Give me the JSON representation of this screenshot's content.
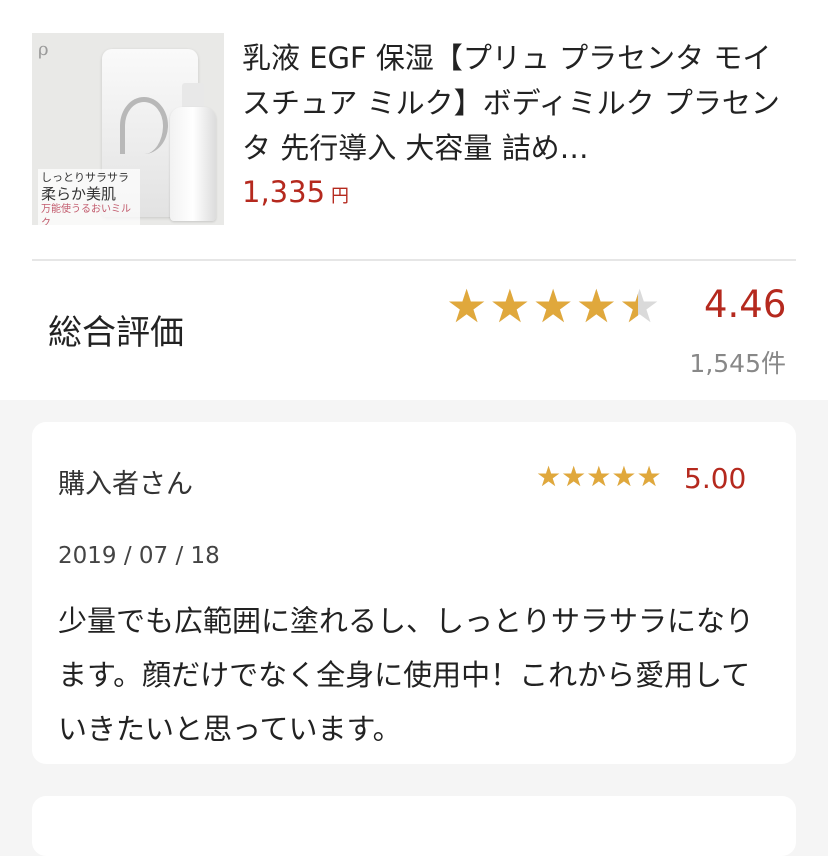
{
  "product": {
    "image_label_lines": [
      "しっとりサラサラ",
      "柔らか美肌",
      "万能使うるおいミルク"
    ],
    "title": "乳液 EGF 保湿【プリュ プラセンタ モイスチュア ミルク】ボディミルク プラセンタ 先行導入 大容量 詰め…",
    "price": "1,335",
    "price_unit": "円"
  },
  "overall": {
    "label": "総合評価",
    "rating": 4.46,
    "rating_text": "4.46",
    "count_text": "1,545件",
    "star_color": "#e0a83c",
    "accent_color": "#b5291e"
  },
  "review": {
    "reviewer": "購入者さん",
    "rating": 5.0,
    "rating_text": "5.00",
    "date": "2019 / 07 / 18",
    "body": "少量でも広範囲に塗れるし、しっとりサラサラになります。顔だけでなく全身に使用中！これから愛用していきたいと思っています。"
  }
}
